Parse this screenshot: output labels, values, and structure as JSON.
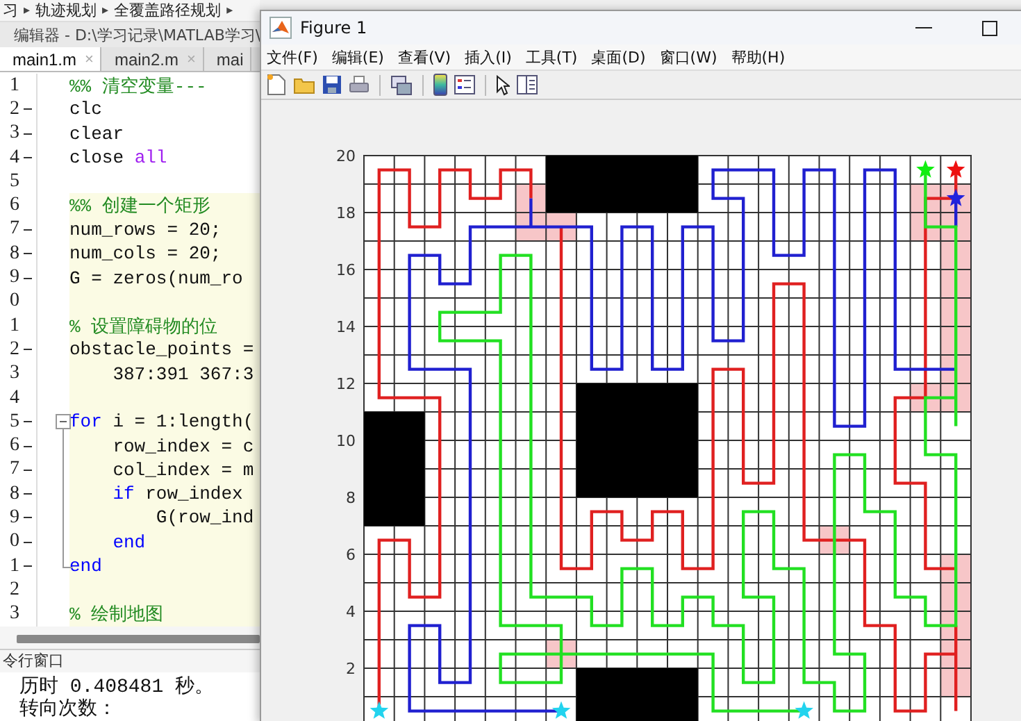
{
  "breadcrumb": {
    "items": [
      "习",
      "轨迹规划",
      "全覆盖路径规划"
    ],
    "separator": "▸"
  },
  "editor": {
    "title": "编辑器 - D:\\学习记录\\MATLAB学习\\",
    "tabs": [
      {
        "label": "main1.m",
        "close": "×",
        "selected": true
      },
      {
        "label": "main2.m",
        "close": "×",
        "selected": false
      },
      {
        "label": "mai",
        "selected": false
      }
    ],
    "lines": [
      {
        "number": "1",
        "executable": false,
        "in_cell": false,
        "in_fold": false,
        "parts": [
          {
            "kind": "comment",
            "text": "%% 清空变量---"
          }
        ]
      },
      {
        "number": "2",
        "executable": true,
        "in_cell": false,
        "in_fold": false,
        "parts": [
          {
            "kind": "code",
            "text": "clc"
          }
        ]
      },
      {
        "number": "3",
        "executable": true,
        "in_cell": false,
        "in_fold": false,
        "parts": [
          {
            "kind": "code",
            "text": "clear"
          }
        ]
      },
      {
        "number": "4",
        "executable": true,
        "in_cell": false,
        "in_fold": false,
        "parts": [
          {
            "kind": "code",
            "text": "close "
          },
          {
            "kind": "builtin",
            "text": "all"
          }
        ]
      },
      {
        "number": "5",
        "executable": false,
        "in_cell": false,
        "in_fold": false
      },
      {
        "number": "6",
        "executable": false,
        "in_cell": true,
        "in_fold": false,
        "parts": [
          {
            "kind": "comment",
            "text": "%% 创建一个矩形"
          }
        ]
      },
      {
        "number": "7",
        "executable": true,
        "in_cell": true,
        "in_fold": false,
        "parts": [
          {
            "kind": "code",
            "text": "num_rows = 20;"
          }
        ]
      },
      {
        "number": "8",
        "executable": true,
        "in_cell": true,
        "in_fold": false,
        "parts": [
          {
            "kind": "code",
            "text": "num_cols = 20;"
          }
        ]
      },
      {
        "number": "9",
        "executable": true,
        "in_cell": true,
        "in_fold": false,
        "parts": [
          {
            "kind": "code",
            "text": "G = zeros(num_ro"
          }
        ]
      },
      {
        "number": "0",
        "executable": false,
        "in_cell": true,
        "in_fold": false
      },
      {
        "number": "1",
        "executable": false,
        "in_cell": true,
        "in_fold": false,
        "parts": [
          {
            "kind": "comment",
            "text": "% 设置障碍物的位"
          }
        ]
      },
      {
        "number": "2",
        "executable": true,
        "in_cell": true,
        "in_fold": false,
        "parts": [
          {
            "kind": "code",
            "text": "obstacle_points ="
          }
        ]
      },
      {
        "number": "3",
        "executable": false,
        "in_cell": true,
        "in_fold": false,
        "parts": [
          {
            "kind": "code",
            "text": "    387:391 367:3"
          }
        ]
      },
      {
        "number": "4",
        "executable": false,
        "in_cell": true,
        "in_fold": false
      },
      {
        "number": "5",
        "executable": true,
        "in_cell": true,
        "in_fold": true,
        "parts": [
          {
            "kind": "keyword",
            "text": "for"
          },
          {
            "kind": "code",
            "text": " i = 1:length("
          }
        ]
      },
      {
        "number": "6",
        "executable": true,
        "in_cell": true,
        "in_fold": true,
        "parts": [
          {
            "kind": "code",
            "text": "    row_index = c"
          }
        ]
      },
      {
        "number": "7",
        "executable": true,
        "in_cell": true,
        "in_fold": true,
        "parts": [
          {
            "kind": "code",
            "text": "    col_index = m"
          }
        ]
      },
      {
        "number": "8",
        "executable": true,
        "in_cell": true,
        "in_fold": true,
        "parts": [
          {
            "kind": "keyword",
            "text": "    if"
          },
          {
            "kind": "code",
            "text": " row_index"
          }
        ]
      },
      {
        "number": "9",
        "executable": true,
        "in_cell": true,
        "in_fold": true,
        "parts": [
          {
            "kind": "code",
            "text": "        G(row_ind"
          }
        ]
      },
      {
        "number": "0",
        "executable": true,
        "in_cell": true,
        "in_fold": true,
        "parts": [
          {
            "kind": "keyword",
            "text": "    end"
          }
        ]
      },
      {
        "number": "1",
        "executable": true,
        "in_cell": true,
        "in_fold": true,
        "parts": [
          {
            "kind": "keyword",
            "text": "end"
          }
        ]
      },
      {
        "number": "2",
        "executable": false,
        "in_cell": true,
        "in_fold": false
      },
      {
        "number": "3",
        "executable": false,
        "in_cell": true,
        "in_fold": false,
        "parts": [
          {
            "kind": "comment",
            "text": "% 绘制地图"
          }
        ]
      }
    ]
  },
  "command_window": {
    "title": "令行窗口",
    "lines": [
      "历时 0.408481 秒。",
      "转向次数："
    ]
  },
  "figure": {
    "title": "Figure 1",
    "menu": [
      "文件(F)",
      "编辑(E)",
      "查看(V)",
      "插入(I)",
      "工具(T)",
      "桌面(D)",
      "窗口(W)",
      "帮助(H)"
    ],
    "yticks": [
      "20",
      "18",
      "16",
      "14",
      "12",
      "10",
      "8",
      "6",
      "4",
      "2"
    ]
  }
}
